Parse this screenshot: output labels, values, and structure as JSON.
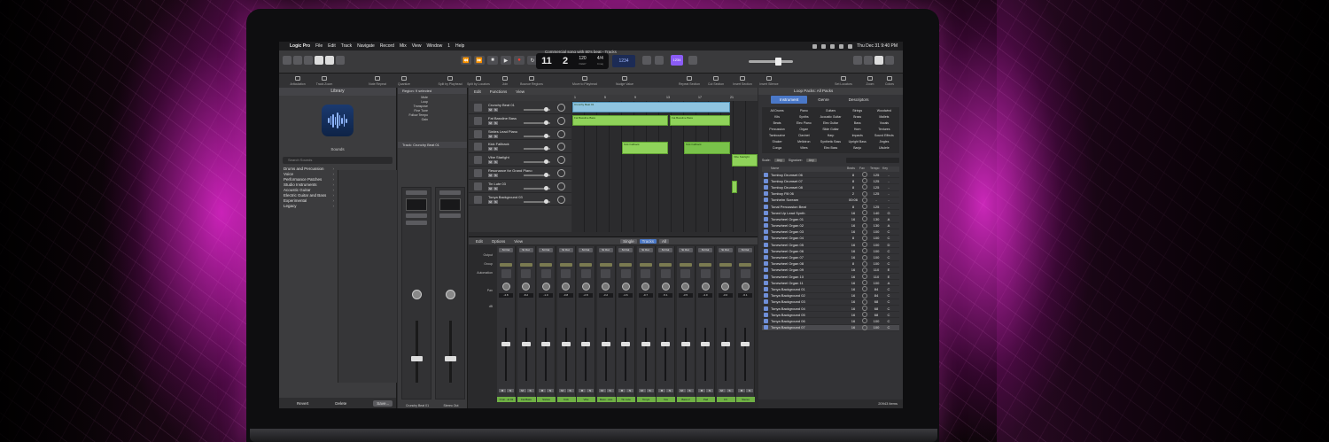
{
  "menubar": {
    "app": "Logic Pro",
    "items": [
      "File",
      "Edit",
      "Track",
      "Navigate",
      "Record",
      "Mix",
      "View",
      "Window",
      "1",
      "Help"
    ],
    "clock": "Thu Dec 31  9:40 PM"
  },
  "control_bar": {
    "window_title": "Commercial song with 80's beat - Tracks",
    "lcd_bar": "11",
    "lcd_beat": "2",
    "lcd_bar_label": "BAR",
    "lcd_beat_label": "BEAT",
    "tempo": "120",
    "tempo_label": "KEEP",
    "time_sig": "4/4",
    "key": "Cmaj",
    "count_in": "1234",
    "purple_label": "1234"
  },
  "toolbar": {
    "tools": [
      "Articulation",
      "Track Zoom",
      "Note Repeat",
      "Quantize",
      "Split by Playhead",
      "Split by Locators",
      "Join",
      "Bounce Regions",
      "Move to Playhead",
      "Nudge Value",
      "Repeat Section",
      "Cut Section",
      "Insert Section",
      "Insert Silence",
      "Set Locators",
      "Zoom",
      "Colors"
    ]
  },
  "library": {
    "title": "Library",
    "sounds_label": "Sounds",
    "search_placeholder": "Search Sounds",
    "categories": [
      "Drums and Percussion",
      "Voice",
      "Performance Patches",
      "Studio Instruments",
      "Acoustic Guitar",
      "Electric Guitar and Bass",
      "Experimental",
      "Legacy"
    ],
    "revert": "Revert",
    "delete": "Delete",
    "save": "Save..."
  },
  "inspector": {
    "region_header": "Region: 9 selected",
    "rows": [
      "Mute",
      "Loop",
      "Transpose",
      "Fine Tune",
      "Follow Tempo",
      "Gain"
    ],
    "track_header": "Track: Crunchy Beat 01",
    "channel_names": [
      "Crunchy Beat 01",
      "Stereo Out"
    ]
  },
  "tracks": {
    "menu": [
      "Edit",
      "Functions",
      "View"
    ],
    "ruler": [
      "1",
      "5",
      "9",
      "13",
      "17",
      "21"
    ],
    "rows": [
      {
        "name": "Crunchy Beat 01"
      },
      {
        "name": "Fat Bassline Bass"
      },
      {
        "name": "Sixties Lead Piano"
      },
      {
        "name": "Kick Fallback"
      },
      {
        "name": "Vibe Starlight"
      },
      {
        "name": "Resonance for Grand Piano"
      },
      {
        "name": "Tin Lute 03"
      },
      {
        "name": "Tonya Background 03"
      }
    ],
    "regions": [
      "Crunchy Beat 01",
      "Fat Bassline Bass",
      "Fat Bassline Bass",
      "Kick Fallback",
      "Kick Fallback",
      "Vibe Starlight"
    ]
  },
  "mixer": {
    "menu": [
      "Edit",
      "Options",
      "View"
    ],
    "modes": [
      "Single",
      "Tracks",
      "All"
    ],
    "active_mode": "Tracks",
    "row_labels": [
      "Output",
      "Group",
      "Automation",
      "",
      "Pan",
      "dB"
    ],
    "output": "St Out",
    "read": "Read",
    "values": [
      "-4.8",
      "-8.2",
      "-1.0",
      "-0.8",
      "-2.8",
      "-3.2",
      "-4.6",
      "-0.7",
      "-5.1",
      "-3.5",
      "-4.0",
      "-3.0",
      "-6.1"
    ],
    "names": [
      "Crun...at 01",
      "Fat Bass",
      "Sixties",
      "Kick",
      "Vibe",
      "Reso...ano",
      "Tin Lute",
      "Tonya",
      "Vox",
      "Bass 2",
      "Pad",
      "FX",
      "Stereo"
    ]
  },
  "loops": {
    "header": "Loop Packs:  All Packs",
    "tabs": [
      "Instrument",
      "Genre",
      "Descriptors"
    ],
    "active_tab": "Instrument",
    "grid": [
      "All Drums",
      "Piano",
      "Guitars",
      "Strings",
      "Woodwind",
      "Kits",
      "Synths",
      "Acoustic Guitar",
      "Brass",
      "Mallets",
      "Beats",
      "Elec Piano",
      "Elec Guitar",
      "Bass",
      "Vocals",
      "Percussion",
      "Organ",
      "Slide Guitar",
      "Horn",
      "Textures",
      "Tambourine",
      "Clavinet",
      "Harp",
      "Impacts",
      "Sound Effects",
      "Shaker",
      "Mellotron",
      "Synthetic Bass",
      "Upright Bass",
      "Jingles",
      "Conga",
      "Vibes",
      "Elec Bass",
      "Banjo",
      "Ukulele"
    ],
    "hint": "Click to find loops by instrument, genre, and descriptor.",
    "scale_label": "Scale:",
    "scale_value": "Any",
    "signature_label": "Signature:",
    "signature_value": "Any",
    "columns": [
      "Name",
      "Beats",
      "Fav",
      "Tempo",
      "Key"
    ],
    "rows": [
      {
        "name": "Tomboy Drumset 06",
        "beats": "8",
        "tempo": "125",
        "key": "-"
      },
      {
        "name": "Tomboy Drumset 07",
        "beats": "8",
        "tempo": "125",
        "key": "-"
      },
      {
        "name": "Tomboy Drumset 08",
        "beats": "8",
        "tempo": "125",
        "key": "-"
      },
      {
        "name": "Tomboy Fill 06",
        "beats": "2",
        "tempo": "125",
        "key": "-"
      },
      {
        "name": "Tomhelm Scream",
        "beats": "00:06",
        "tempo": "-",
        "key": "-"
      },
      {
        "name": "Tonal Percussion Beat",
        "beats": "8",
        "tempo": "125",
        "key": "-"
      },
      {
        "name": "Toned Up Lead Synth",
        "beats": "16",
        "tempo": "140",
        "key": "G"
      },
      {
        "name": "Tonewheel Organ 01",
        "beats": "16",
        "tempo": "130",
        "key": "A"
      },
      {
        "name": "Tonewheel Organ 02",
        "beats": "16",
        "tempo": "130",
        "key": "A"
      },
      {
        "name": "Tonewheel Organ 03",
        "beats": "16",
        "tempo": "100",
        "key": "C"
      },
      {
        "name": "Tonewheel Organ 04",
        "beats": "8",
        "tempo": "100",
        "key": "C"
      },
      {
        "name": "Tonewheel Organ 05",
        "beats": "16",
        "tempo": "100",
        "key": "D"
      },
      {
        "name": "Tonewheel Organ 06",
        "beats": "16",
        "tempo": "100",
        "key": "C"
      },
      {
        "name": "Tonewheel Organ 07",
        "beats": "16",
        "tempo": "100",
        "key": "C"
      },
      {
        "name": "Tonewheel Organ 08",
        "beats": "8",
        "tempo": "100",
        "key": "C"
      },
      {
        "name": "Tonewheel Organ 09",
        "beats": "16",
        "tempo": "110",
        "key": "E"
      },
      {
        "name": "Tonewheel Organ 10",
        "beats": "16",
        "tempo": "110",
        "key": "E"
      },
      {
        "name": "Tonewheel Organ 11",
        "beats": "16",
        "tempo": "100",
        "key": "A"
      },
      {
        "name": "Tonya Background 01",
        "beats": "16",
        "tempo": "84",
        "key": "C"
      },
      {
        "name": "Tonya Background 02",
        "beats": "16",
        "tempo": "84",
        "key": "C"
      },
      {
        "name": "Tonya Background 03",
        "beats": "16",
        "tempo": "68",
        "key": "C"
      },
      {
        "name": "Tonya Background 04",
        "beats": "16",
        "tempo": "68",
        "key": "C"
      },
      {
        "name": "Tonya Background 05",
        "beats": "16",
        "tempo": "68",
        "key": "C"
      },
      {
        "name": "Tonya Background 06",
        "beats": "16",
        "tempo": "100",
        "key": "C"
      },
      {
        "name": "Tonya Background 07",
        "beats": "16",
        "tempo": "100",
        "key": "C"
      }
    ],
    "item_count": "20943 items"
  }
}
